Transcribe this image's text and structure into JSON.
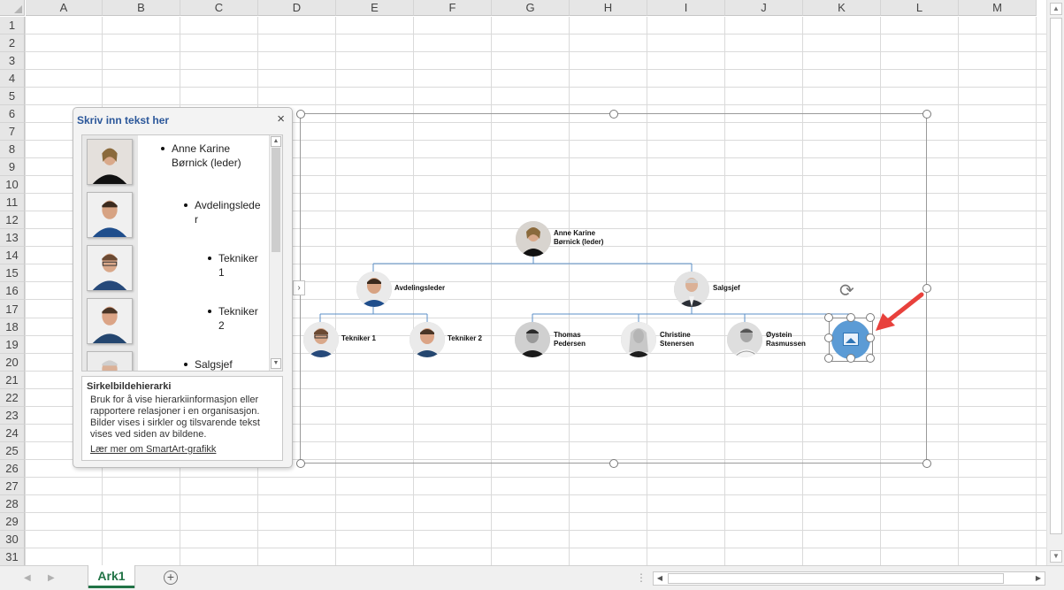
{
  "columns": [
    "A",
    "B",
    "C",
    "D",
    "E",
    "F",
    "G",
    "H",
    "I",
    "J",
    "K",
    "L",
    "M"
  ],
  "rows": [
    "1",
    "2",
    "3",
    "4",
    "5",
    "6",
    "7",
    "8",
    "9",
    "10",
    "11",
    "12",
    "13",
    "14",
    "15",
    "16",
    "17",
    "18",
    "19",
    "20",
    "21",
    "22",
    "23",
    "24",
    "25",
    "26",
    "27",
    "28",
    "29",
    "30",
    "31"
  ],
  "text_pane": {
    "title": "Skriv inn tekst her",
    "close_glyph": "×",
    "items": [
      {
        "line1": "Anne Karine",
        "line2": "Børnick (leder)"
      },
      {
        "line1": "Avdelingslede",
        "line2": "r"
      },
      {
        "line1": "Tekniker",
        "line2": "1"
      },
      {
        "line1": "Tekniker",
        "line2": "2"
      },
      {
        "line1": "Salgsjef",
        "line2": ""
      }
    ],
    "description": {
      "title": "Sirkelbildehierarki",
      "text": "Bruk for å vise hierarkiinformasjon eller rapportere relasjoner i en organisasjon. Bilder vises i sirkler og tilsvarende tekst vises ved siden av bildene.",
      "link": "Lær mer om SmartArt-grafikk"
    },
    "expand_glyph": "›"
  },
  "org_chart": {
    "leader": {
      "line1": "Anne Karine",
      "line2": "Børnick (leder)"
    },
    "dept_lead": {
      "line1": "Avdelingsleder"
    },
    "sales_lead": {
      "line1": "Salgsjef"
    },
    "tech1": {
      "line1": "Tekniker 1"
    },
    "tech2": {
      "line1": "Tekniker 2"
    },
    "thomas": {
      "line1": "Thomas",
      "line2": "Pedersen"
    },
    "christine": {
      "line1": "Christine",
      "line2": "Stenersen"
    },
    "oystein": {
      "line1": "Øystein",
      "line2": "Rasmussen"
    }
  },
  "colors": {
    "connector": "#5b8fc7",
    "placeholder": "#5b9bd5",
    "arrow": "#e8413c",
    "tab_accent": "#217346"
  },
  "bottom_bar": {
    "sheet_tab": "Ark1",
    "add_sheet": "+",
    "split": "⋮"
  },
  "icons": {
    "rotate": "⟳",
    "scroll_up": "▲",
    "scroll_down": "▼",
    "scroll_left": "◀",
    "scroll_right": "▶"
  }
}
